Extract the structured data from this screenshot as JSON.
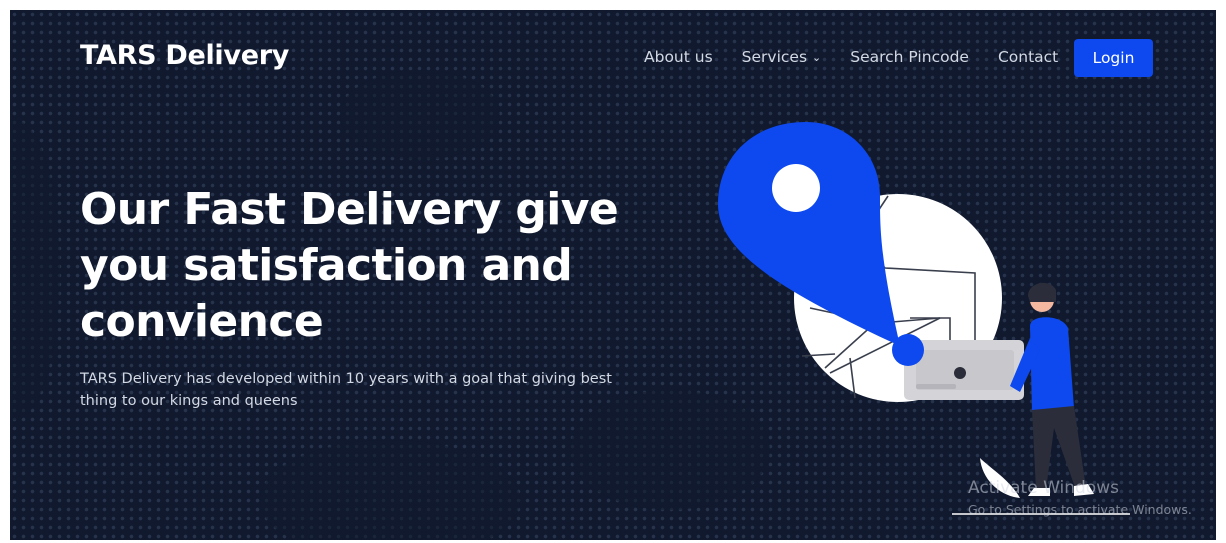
{
  "brand": {
    "name": "TARS Delivery"
  },
  "nav": {
    "items": [
      {
        "label": "About us"
      },
      {
        "label": "Services",
        "has_dropdown": true
      },
      {
        "label": "Search Pincode"
      },
      {
        "label": "Contact"
      }
    ],
    "login_label": "Login"
  },
  "hero": {
    "title": "Our Fast Delivery give you satisfaction and convience",
    "subtitle": "TARS Delivery has developed within 10 years with a goal that giving best thing to our kings and queens"
  },
  "illustration": {
    "icon": "map-pin-courier-illustration"
  },
  "watermark": {
    "title": "Activate Windows",
    "subtitle": "Go to Settings to activate Windows."
  },
  "colors": {
    "background": "#10192e",
    "accent": "#0d49ee",
    "text": "#ffffff",
    "muted_text": "#d3d9e4"
  }
}
